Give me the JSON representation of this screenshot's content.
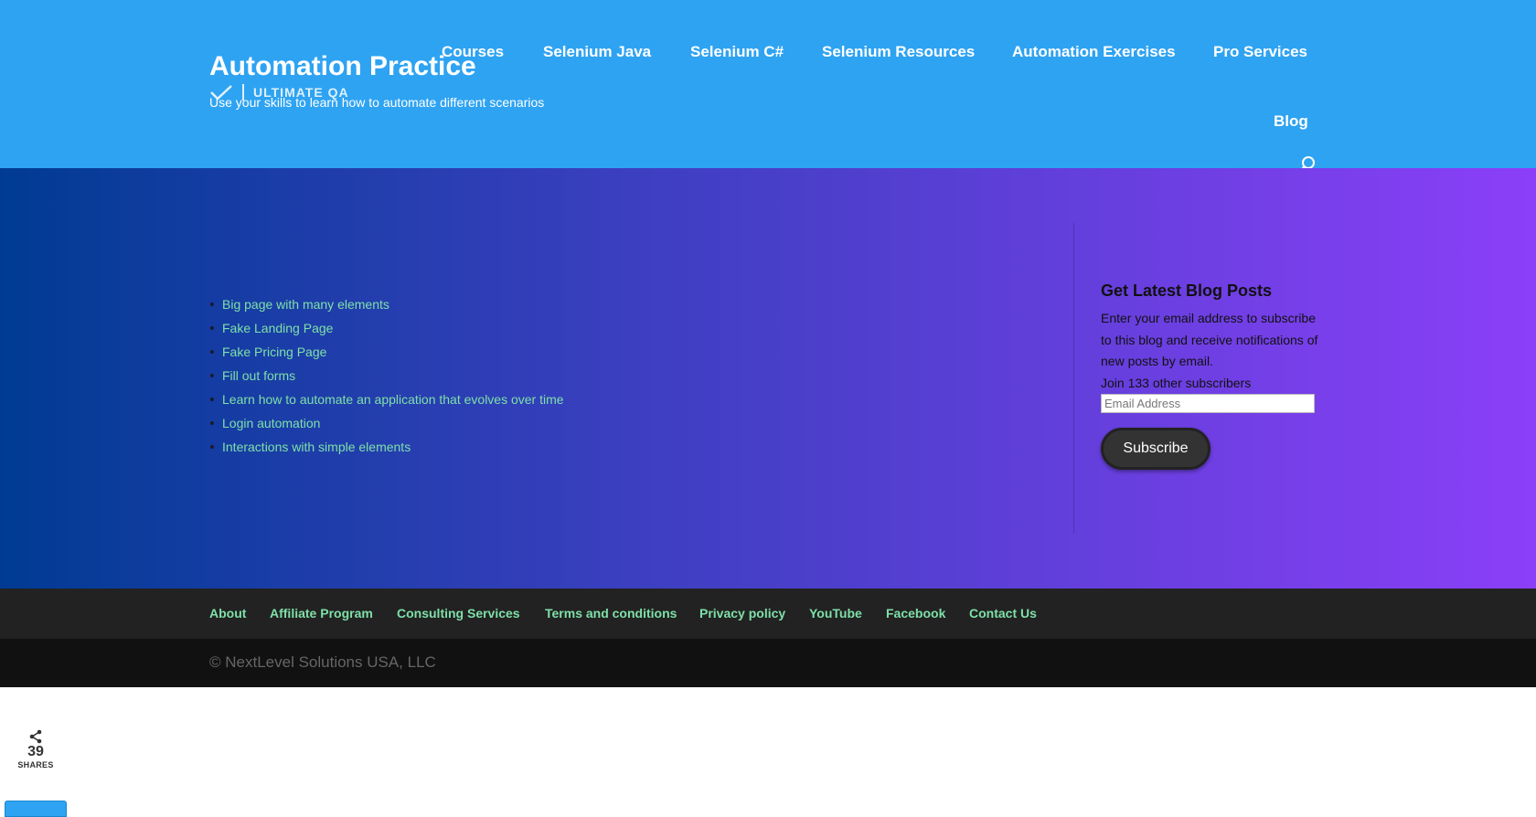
{
  "header": {
    "site_title": "Automation Practice",
    "tagline": "Use your skills to learn how to automate different scenarios",
    "logo_text": "ULTIMATE QA",
    "nav": [
      {
        "label": "Courses"
      },
      {
        "label": "Selenium Java"
      },
      {
        "label": "Selenium C#"
      },
      {
        "label": "Selenium Resources"
      },
      {
        "label": "Automation Exercises"
      },
      {
        "label": "Pro Services"
      },
      {
        "label": "Blog"
      }
    ],
    "search_icon": "search-icon"
  },
  "main": {
    "links": [
      "Big page with many elements",
      "Fake Landing Page",
      "Fake Pricing Page",
      "Fill out forms",
      "Learn how to automate an application that evolves over time",
      "Login automation",
      "Interactions with simple elements"
    ]
  },
  "widget": {
    "title": "Get Latest Blog Posts",
    "description": "Enter your email address to subscribe to this blog and receive notifications of new posts by email.",
    "join_text": "Join 133 other subscribers",
    "email_placeholder": "Email Address",
    "subscribe_label": "Subscribe"
  },
  "footer": {
    "links": [
      "About",
      "Affiliate Program",
      "Consulting Services",
      "Terms and conditions",
      "Privacy policy",
      "YouTube",
      "Facebook",
      "Contact Us"
    ],
    "copyright": "© NextLevel Solutions USA, LLC"
  },
  "share": {
    "count": "39",
    "label": "SHARES",
    "icon": "share-icon"
  },
  "colors": {
    "header_bg": "#2ea3f2",
    "gradient_start": "#003b93",
    "gradient_end": "#8b3ff8",
    "link_green": "#7ee0a8",
    "footer_bg": "#222222",
    "footer_bottom_bg": "#111111"
  }
}
